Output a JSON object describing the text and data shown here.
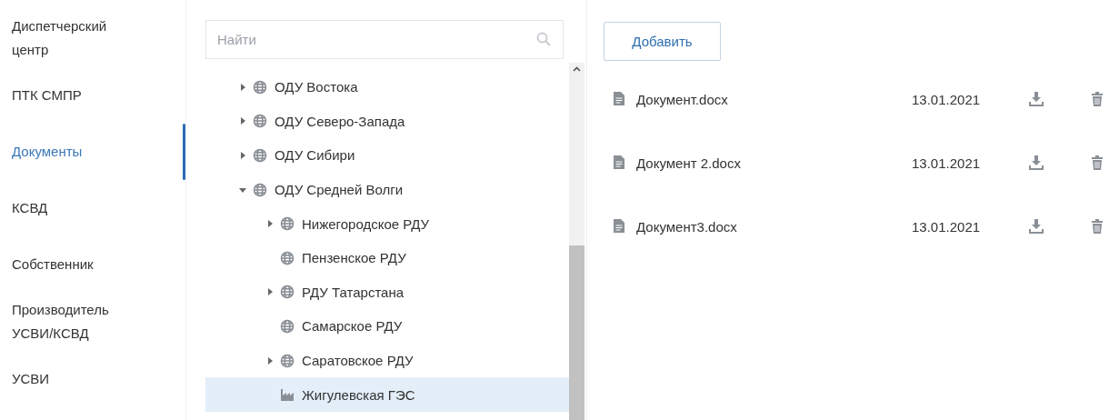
{
  "nav": [
    {
      "label": "Диспетчерский центр",
      "selected": false
    },
    {
      "label": "ПТК СМПР",
      "selected": false
    },
    {
      "label": "Документы",
      "selected": true
    },
    {
      "label": "КСВД",
      "selected": false
    },
    {
      "label": "Собственник",
      "selected": false
    },
    {
      "label": "Производитель УСВИ/КСВД",
      "selected": false
    },
    {
      "label": "УСВИ",
      "selected": false
    }
  ],
  "search": {
    "placeholder": "Найти"
  },
  "tree": [
    {
      "label": "ОДУ Востока",
      "kind": "globe",
      "expanded": false,
      "selected": false
    },
    {
      "label": "ОДУ Северо-Запада",
      "kind": "globe",
      "expanded": false,
      "selected": false
    },
    {
      "label": "ОДУ Сибири",
      "kind": "globe",
      "expanded": false,
      "selected": false
    },
    {
      "label": "ОДУ Средней Волги",
      "kind": "globe",
      "expanded": true,
      "selected": false,
      "children": [
        {
          "label": "Нижегородское РДУ",
          "kind": "globe",
          "expanded": false,
          "selected": false
        },
        {
          "label": "Пензенское РДУ",
          "kind": "globe",
          "selected": false
        },
        {
          "label": "РДУ Татарстана",
          "kind": "globe",
          "expanded": false,
          "selected": false
        },
        {
          "label": "Самарское РДУ",
          "kind": "globe",
          "selected": false
        },
        {
          "label": "Саратовское РДУ",
          "kind": "globe",
          "expanded": false,
          "selected": false
        },
        {
          "label": "Жигулевская ГЭС",
          "kind": "plant",
          "selected": true
        }
      ]
    }
  ],
  "add_button": "Добавить",
  "files": [
    {
      "name": "Документ.docx",
      "date": "13.01.2021"
    },
    {
      "name": "Документ 2.docx",
      "date": "13.01.2021"
    },
    {
      "name": "Документ3.docx",
      "date": "13.01.2021"
    }
  ]
}
